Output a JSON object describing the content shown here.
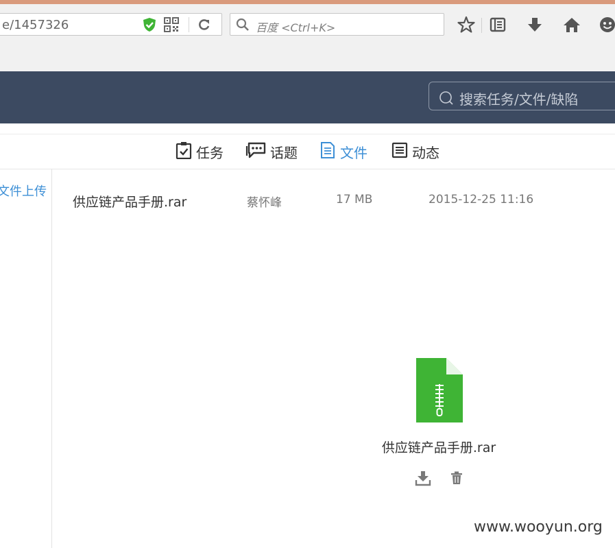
{
  "browser": {
    "url": "e/1457326",
    "search_placeholder": "百度 <Ctrl+K>",
    "icons": [
      "shield-icon",
      "qr-code-icon",
      "reload-icon",
      "search-icon",
      "star-icon",
      "reading-list-icon",
      "download-icon",
      "home-icon",
      "emoji-icon"
    ]
  },
  "app": {
    "search_placeholder": "搜索任务/文件/缺陷",
    "tabs": [
      {
        "label": "任务",
        "icon": "clipboard-check-icon"
      },
      {
        "label": "话题",
        "icon": "chat-bubble-icon"
      },
      {
        "label": "文件",
        "icon": "document-icon",
        "active": true
      },
      {
        "label": "动态",
        "icon": "list-icon"
      }
    ],
    "accent_color": "#3d8fd6",
    "header_color": "#3c4a61"
  },
  "sidebar": {
    "link": "文件上传"
  },
  "files": [
    {
      "name": "供应链产品手册.rar",
      "owner": "蔡怀峰",
      "size": "17 MB",
      "date": "2015-12-25 11:16"
    }
  ],
  "preview": {
    "name": "供应链产品手册.rar",
    "icon": "zip-file-icon",
    "icon_color": "#3fb435",
    "actions": [
      "download-icon",
      "delete-icon"
    ]
  },
  "watermark": "www.wooyun.org"
}
